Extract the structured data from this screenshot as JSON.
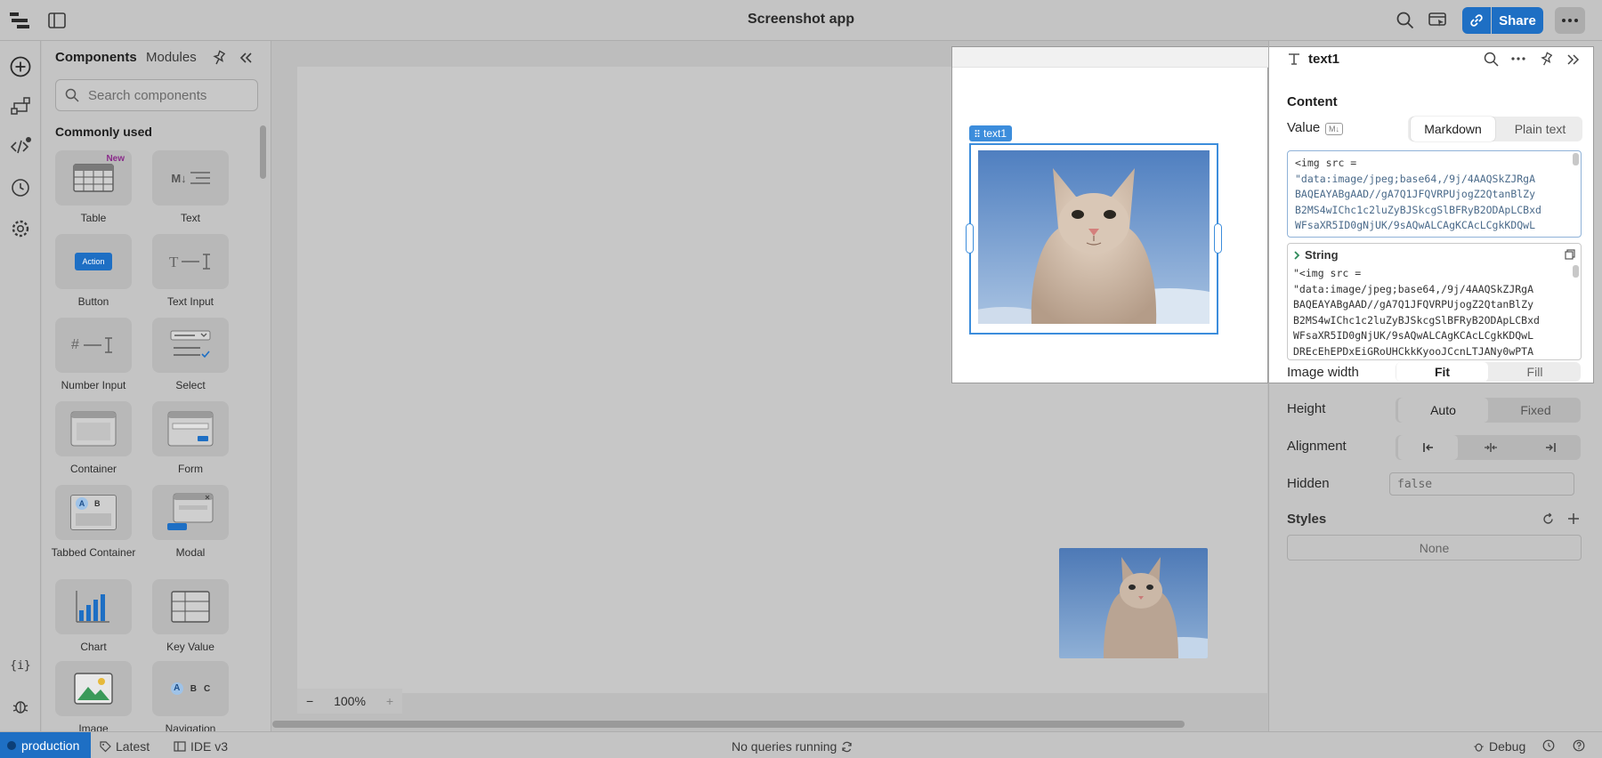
{
  "app": {
    "title": "Screenshot app"
  },
  "topbar": {
    "share_label": "Share"
  },
  "panel": {
    "tab_components": "Components",
    "tab_modules": "Modules",
    "search_placeholder": "Search components",
    "section_title": "Commonly used",
    "items": [
      {
        "label": "Table",
        "badge": "New"
      },
      {
        "label": "Text",
        "glyph": "M↓"
      },
      {
        "label": "Button",
        "glyph": "Action"
      },
      {
        "label": "Text Input"
      },
      {
        "label": "Number Input",
        "glyph": "#"
      },
      {
        "label": "Select"
      },
      {
        "label": "Container"
      },
      {
        "label": "Form"
      },
      {
        "label": "Tabbed Container",
        "glyph_a": "A",
        "glyph_b": "B"
      },
      {
        "label": "Modal"
      },
      {
        "label": "Chart"
      },
      {
        "label": "Key Value"
      },
      {
        "label": "Image"
      },
      {
        "label": "Navigation",
        "glyph_a": "A",
        "glyph_b": "B",
        "glyph_c": "C"
      }
    ]
  },
  "canvas": {
    "zoom": "100%",
    "selected_tag": "text1"
  },
  "inspector": {
    "component_name": "text1",
    "content_heading": "Content",
    "value_label": "Value",
    "value_badge": "M↓",
    "mode_markdown": "Markdown",
    "mode_plain": "Plain text",
    "code_lines": [
      "<img src =",
      "\"data:image/jpeg;base64,/9j/4AAQSkZJRgA",
      "BAQEAYABgAAD//gA7Q1JFQVRPUjogZ2QtanBlZy",
      "B2MS4wIChc1c2luZyBJSkcgSlBFRyB2ODApLCBxd",
      "WFsaXR5ID0gNjUK/9sAQwALCAgKCAcLCgkKDQwL"
    ],
    "string_label": "String",
    "string_lines": [
      "\"<img src =",
      "\"data:image/jpeg;base64,/9j/4AAQSkZJRgA",
      "BAQEAYABgAAD//gA7Q1JFQVRPUjogZ2QtanBlZy",
      "B2MS4wIChc1c2luZyBJSkcgSlBFRyB2ODApLCBxd",
      "WFsaXR5ID0gNjUK/9sAQwALCAgKCAcLCgkKDQwL",
      "DREcEhEPDxEiGRoUHCkkKyooJCcnLTJANy0wPTA"
    ],
    "image_width_label": "Image width",
    "fit": "Fit",
    "fill": "Fill",
    "height_label": "Height",
    "auto": "Auto",
    "fixed": "Fixed",
    "alignment_label": "Alignment",
    "hidden_label": "Hidden",
    "hidden_value": "false",
    "styles_label": "Styles",
    "styles_value": "None"
  },
  "statusbar": {
    "env": "production",
    "version": "Latest",
    "ide": "IDE v3",
    "queries": "No queries running",
    "debug": "Debug"
  },
  "colors": {
    "accent": "#1e6fc4",
    "selection": "#3c8ddc"
  }
}
